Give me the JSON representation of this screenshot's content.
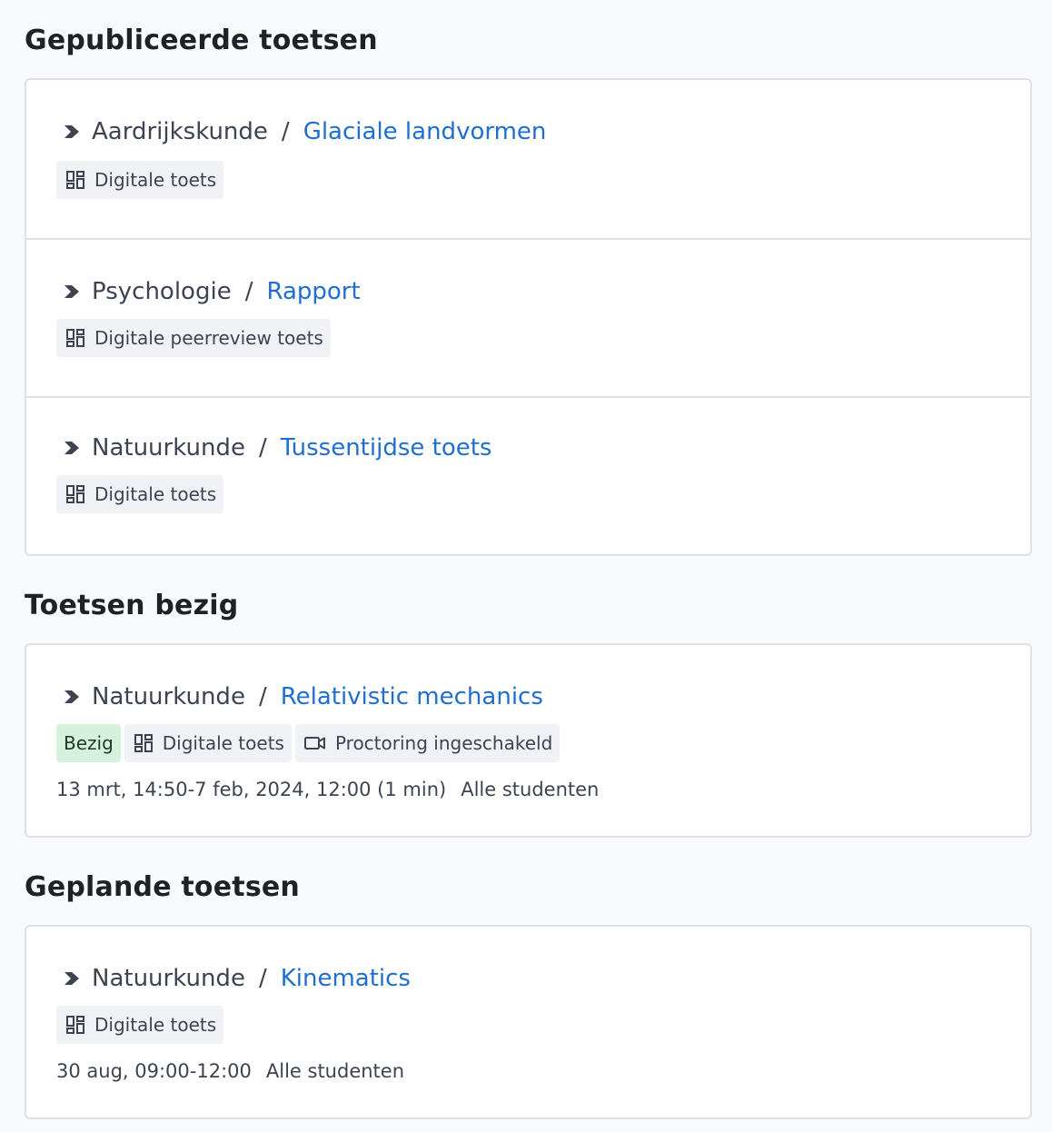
{
  "sections": {
    "published": {
      "title": "Gepubliceerde toetsen",
      "items": [
        {
          "subject": "Aardrijkskunde",
          "title": "Glaciale landvormen",
          "type": "Digitale toets"
        },
        {
          "subject": "Psychologie",
          "title": "Rapport",
          "type": "Digitale peerreview toets"
        },
        {
          "subject": "Natuurkunde",
          "title": "Tussentijdse toets",
          "type": "Digitale toets"
        }
      ]
    },
    "ongoing": {
      "title": "Toetsen bezig",
      "items": [
        {
          "subject": "Natuurkunde",
          "title": "Relativistic mechanics",
          "status": "Bezig",
          "type": "Digitale toets",
          "proctoring": "Proctoring ingeschakeld",
          "schedule": "13 mrt, 14:50-7 feb, 2024, 12:00 (1 min)",
          "audience": "Alle studenten"
        }
      ]
    },
    "planned": {
      "title": "Geplande toetsen",
      "items": [
        {
          "subject": "Natuurkunde",
          "title": "Kinematics",
          "type": "Digitale toets",
          "schedule": "30 aug, 09:00-12:00",
          "audience": "Alle studenten"
        }
      ]
    }
  },
  "separator": "/",
  "icons": {
    "breadcrumb": "chevron-right-icon",
    "test_type": "dashboard-grid-icon",
    "proctoring": "video-camera-icon"
  },
  "colors": {
    "link": "#1f6fd0",
    "status_bg": "#d5f2dc",
    "tag_bg": "#f1f2f5",
    "border": "#dfe1e6"
  }
}
